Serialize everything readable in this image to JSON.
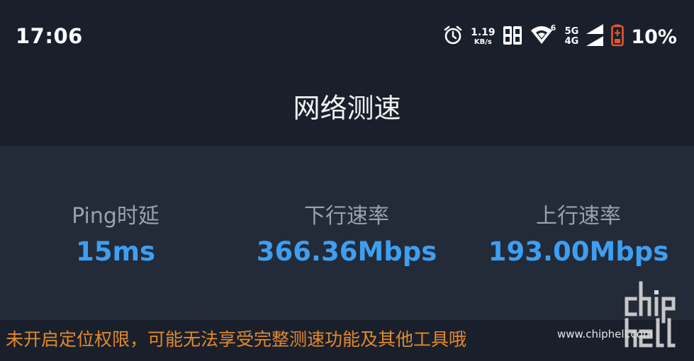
{
  "status_bar": {
    "time": "17:06",
    "net_rate_value": "1.19",
    "net_rate_unit": "KB/s",
    "wifi_badge": "6",
    "net_type_top": "5G",
    "net_type_bottom": "4G",
    "battery_percent": "10%",
    "icons": [
      "alarm-icon",
      "sim-icon",
      "wifi-icon",
      "signal-icon",
      "battery-icon"
    ]
  },
  "header": {
    "title": "网络测速"
  },
  "results": {
    "ping": {
      "label": "Ping时延",
      "value": "15ms"
    },
    "download": {
      "label": "下行速率",
      "value": "366.36Mbps"
    },
    "upload": {
      "label": "上行速率",
      "value": "193.00Mbps"
    }
  },
  "footer": {
    "warning": "未开启定位权限，可能无法享受完整测速功能及其他工具哦"
  },
  "watermark": {
    "url": "www.chiphell.com",
    "logo_text": "chip hell"
  },
  "colors": {
    "background": "#1a1f2c",
    "panel": "#232a38",
    "value_blue": "#3d9ff1",
    "label_gray": "#9aa1ad",
    "warning_orange": "#e18a2e",
    "battery_red": "#e4572e"
  }
}
